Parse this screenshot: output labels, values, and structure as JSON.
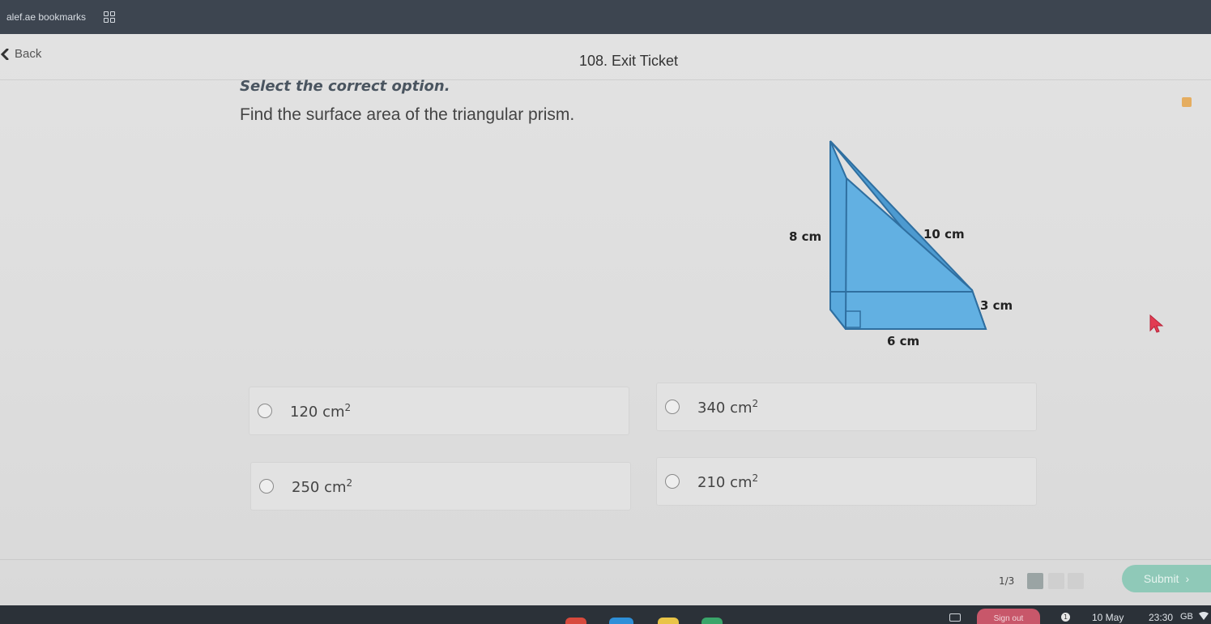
{
  "browser": {
    "bookmarks_label": "alef.ae bookmarks",
    "apps_icon": "apps-grid-icon"
  },
  "header": {
    "back_label": "Back",
    "title": "108. Exit Ticket"
  },
  "question": {
    "instruction": "Select the correct option.",
    "prompt": "Find the surface area of the triangular prism.",
    "figure": {
      "labels": {
        "height": "8 cm",
        "hypotenuse": "10 cm",
        "depth": "3 cm",
        "base": "6 cm"
      },
      "fill_color": "#5aa9dd",
      "stroke_color": "#2f6fa0"
    }
  },
  "options": [
    {
      "value": "120",
      "unit": "cm",
      "exp": "2"
    },
    {
      "value": "340",
      "unit": "cm",
      "exp": "2"
    },
    {
      "value": "250",
      "unit": "cm",
      "exp": "2"
    },
    {
      "value": "210",
      "unit": "cm",
      "exp": "2"
    }
  ],
  "footer": {
    "progress": "1/3",
    "submit_label": "Submit",
    "submit_color": "#8fc9b8"
  },
  "taskbar": {
    "sign_out_label": "Sign out",
    "notification_count": "1",
    "date": "10 May",
    "time": "23:30",
    "storage": "GB"
  }
}
